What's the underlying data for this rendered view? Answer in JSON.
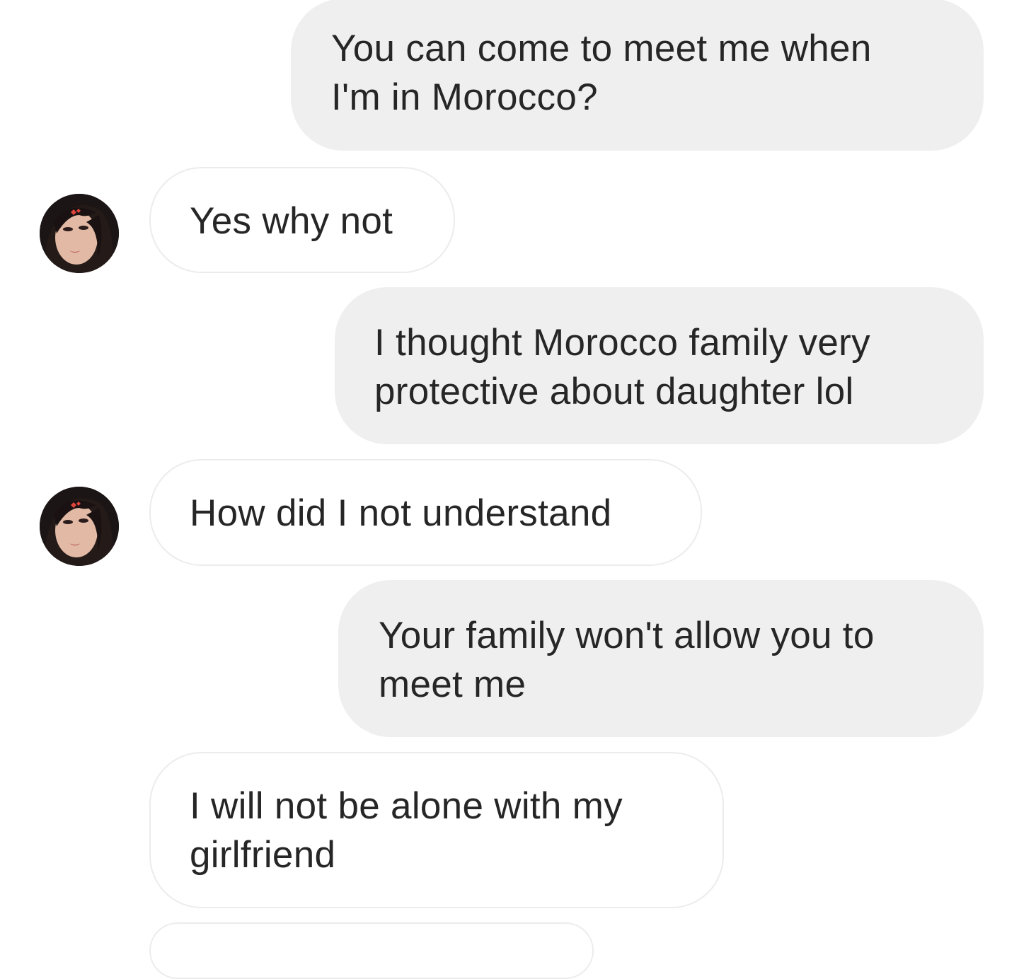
{
  "messages": [
    {
      "sender": "me",
      "text": "You can come to meet me when\nI'm in Morocco?"
    },
    {
      "sender": "them",
      "text": "Yes why not"
    },
    {
      "sender": "me",
      "text": "I thought Morocco family very\nprotective about daughter lol"
    },
    {
      "sender": "them",
      "text": "How did I not understand"
    },
    {
      "sender": "me",
      "text": "Your family won't allow you to\nmeet me"
    },
    {
      "sender": "them",
      "text": "I will not be alone with my\ngirlfriend"
    }
  ],
  "colors": {
    "sent_bubble": "#efefef",
    "received_bubble": "#ffffff",
    "received_border": "#ececec",
    "text": "#262626"
  },
  "icons": {
    "contact_avatar": "contact-avatar-photo"
  }
}
